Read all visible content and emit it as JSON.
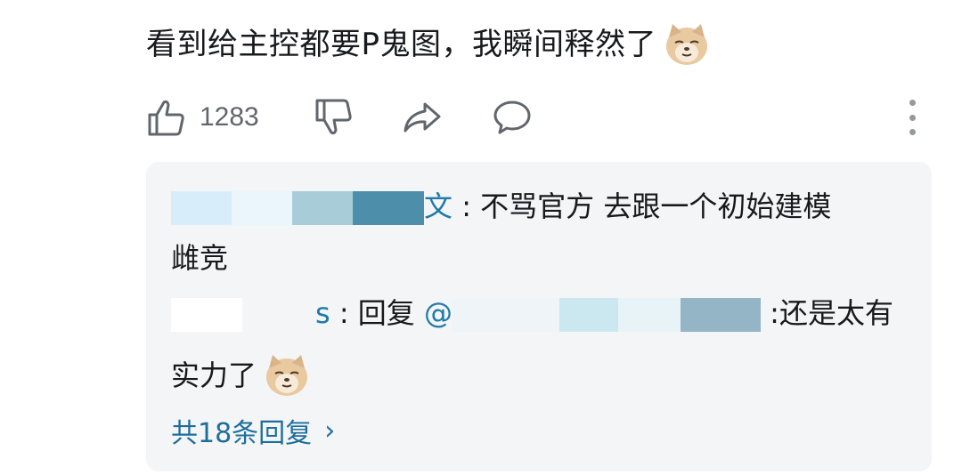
{
  "comment": {
    "text": "看到给主控都要P鬼图，我瞬间释然了",
    "emoji": "shiba-dog-emoji"
  },
  "actions": {
    "like_count": "1283",
    "like_icon": "thumbs-up-icon",
    "dislike_icon": "thumbs-down-icon",
    "share_icon": "share-arrow-icon",
    "reply_icon": "comment-bubble-icon",
    "more_icon": "more-vertical-icon"
  },
  "replies": [
    {
      "username_suffix": "文",
      "text": ": 不骂官方 去跟一个初始建模",
      "text_cont": "雌竞"
    },
    {
      "username_suffix": "s",
      "text": ": 回复 ",
      "mention_suffix": "",
      "text2": ":还是太有",
      "text_cont": "实力了"
    }
  ],
  "more_replies": {
    "label": "共18条回复",
    "chevron": "›"
  },
  "colors": {
    "link": "#1e7aa8",
    "reply_bg": "#f4f5f7",
    "icon_gray": "#61666d"
  }
}
